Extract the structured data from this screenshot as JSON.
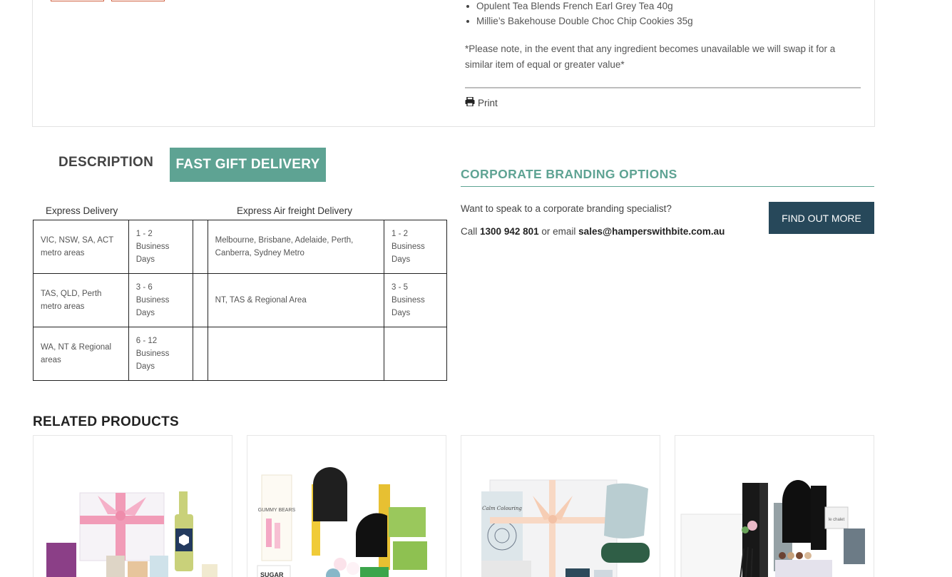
{
  "product": {
    "ingredients": [
      "Opulent Tea Blends French Earl Grey Tea 40g",
      "Millie’s Bakehouse Double Choc Chip Cookies 35g"
    ],
    "note": "*Please note, in the event that any ingredient becomes unavailable we will swap it for a similar item of equal or greater value*",
    "print_label": "Print"
  },
  "tabs": {
    "description": "DESCRIPTION",
    "fast_delivery": "FAST GIFT DELIVERY"
  },
  "delivery": {
    "express_header": "Express Delivery",
    "air_header": "Express Air freight Delivery",
    "rows": [
      {
        "region": "VIC, NSW, SA, ACT metro areas",
        "time": "1 - 2 Business Days",
        "air_region": "Melbourne, Brisbane, Adelaide, Perth, Canberra, Sydney Metro",
        "air_time": "1 - 2 Business Days"
      },
      {
        "region": "TAS, QLD, Perth metro areas",
        "time": "3 - 6 Business Days",
        "air_region": "NT, TAS & Regional Area",
        "air_time": "3 - 5 Business Days"
      },
      {
        "region": "WA, NT & Regional areas",
        "time": "6 - 12 Business Days",
        "air_region": "",
        "air_time": ""
      }
    ]
  },
  "corporate": {
    "title": "CORPORATE BRANDING OPTIONS",
    "question": "Want to speak to a corporate branding specialist?",
    "call_prefix": "Call",
    "phone": "1300 942 801",
    "or_email": "or email",
    "email": "sales@hamperswithbite.com.au",
    "button": "FIND OUT MORE"
  },
  "related": {
    "title": "RELATED PRODUCTS",
    "image_text": {
      "p2_gummy": "GUMMY BEARS",
      "p2_sugar": "SUGAR",
      "p3_book": "Calm Colouring",
      "p4_brand": "le chalet"
    }
  },
  "colors": {
    "accent": "#5ea393",
    "button_dark": "#27485a",
    "stub_border": "#d0603f"
  }
}
